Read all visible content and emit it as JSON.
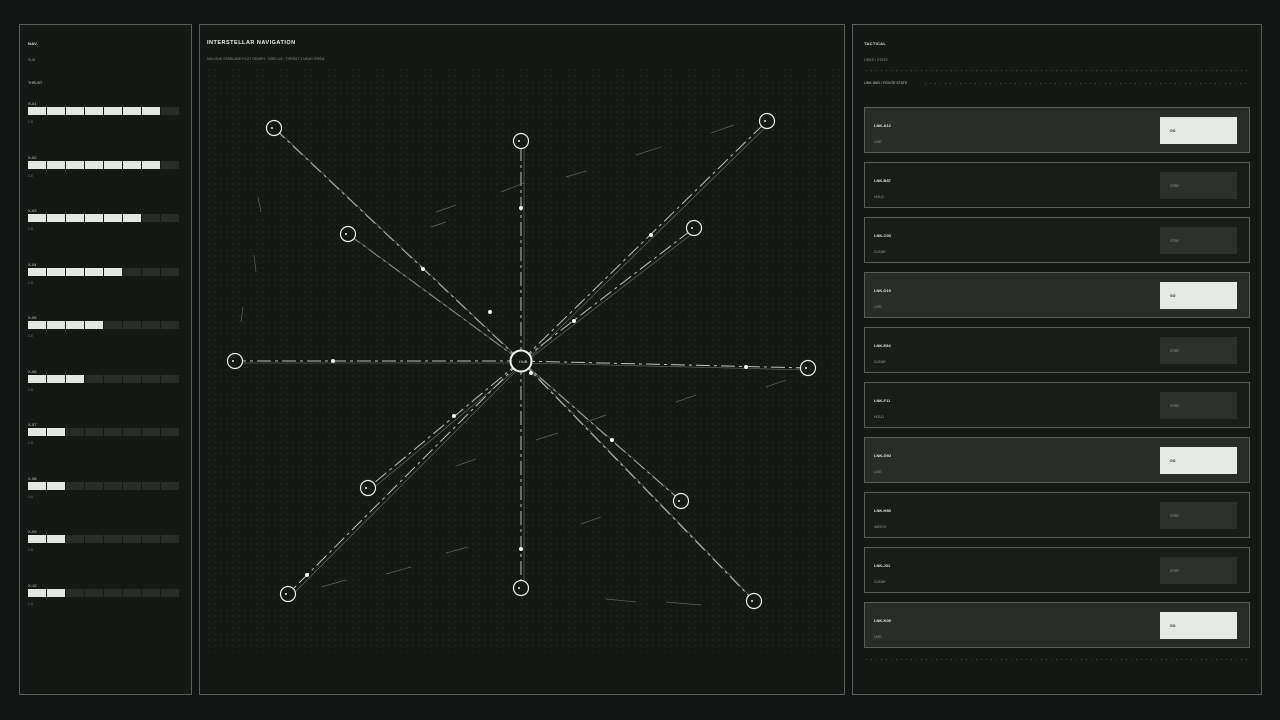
{
  "left": {
    "title": "NAV",
    "subtitle": "SUB",
    "section": "THRUST",
    "rows": [
      {
        "name": "X-01",
        "filled": 7,
        "val": "1.0"
      },
      {
        "name": "X-02",
        "filled": 7,
        "val": "1.0"
      },
      {
        "name": "X-03",
        "filled": 6,
        "val": "1.0"
      },
      {
        "name": "X-04",
        "filled": 5,
        "val": "1.0"
      },
      {
        "name": "X-05",
        "filled": 4,
        "val": "1.0"
      },
      {
        "name": "X-06",
        "filled": 3,
        "val": "1.0"
      },
      {
        "name": "X-07",
        "filled": 2,
        "val": "1.0"
      },
      {
        "name": "X-08",
        "filled": 2,
        "val": "1.0"
      },
      {
        "name": "X-09",
        "filled": 2,
        "val": "1.0"
      },
      {
        "name": "X-10",
        "filled": 2,
        "val": "1.0"
      }
    ]
  },
  "center": {
    "title": "INTERSTELLAR NAVIGATION",
    "subtitle": "NAV-SUK  STARLANE PLOT GRAPH  ·  GRID 4.8  ·  THREAT 3 NEAR GRID4",
    "hub_label": "HUB"
  },
  "right": {
    "title": "TACTICAL",
    "subtitle": "LINKS / STATE",
    "section": "LINK WAY  /  ROUTE STATE",
    "cards": [
      {
        "id": "LNK-A12",
        "state": "LIVE",
        "action": "GO",
        "live": true
      },
      {
        "id": "LNK-B87",
        "state": "HOLD",
        "action": "STBY",
        "live": false
      },
      {
        "id": "LNK-C03",
        "state": "CLEAR",
        "action": "STBY",
        "live": false
      },
      {
        "id": "LNK-D19",
        "state": "LIVE",
        "action": "GO",
        "live": true
      },
      {
        "id": "LNK-E84",
        "state": "CLEAR",
        "action": "STBY",
        "live": false
      },
      {
        "id": "LNK-F11",
        "state": "HOLD",
        "action": "STBY",
        "live": false
      },
      {
        "id": "LNK-G92",
        "state": "LIVE",
        "action": "GO",
        "live": true
      },
      {
        "id": "LNK-H80",
        "state": "WATCH",
        "action": "STBY",
        "live": false
      },
      {
        "id": "LNK-J31",
        "state": "CLEAR",
        "action": "STBY",
        "live": false
      },
      {
        "id": "LNK-K05",
        "state": "LIVE",
        "action": "GO",
        "live": true
      }
    ]
  },
  "colors": {
    "bg": "#121413",
    "panel": "#161816",
    "border": "#5a5d59",
    "accent": "#e6e8e4"
  }
}
